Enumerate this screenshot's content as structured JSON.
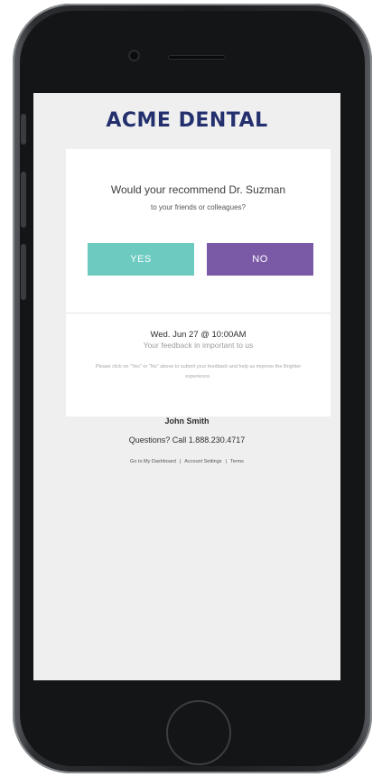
{
  "app": {
    "brand": "ACME DENTAL"
  },
  "survey": {
    "question": "Would your recommend Dr. Suzman",
    "sub_question": "to your friends or colleagues?",
    "yes_label": "YES",
    "no_label": "NO"
  },
  "appointment": {
    "date_line": "Wed. Jun 27 @ 10:00AM",
    "feedback_note": "Your feedback in important to us",
    "instructions": "Please click on \"Yes\" or \"No\" above to submit your feedback and help us improve the Brighter experience."
  },
  "footer": {
    "user_name": "John Smith",
    "questions_line": "Questions? Call 1.888.230.4717",
    "links": {
      "dashboard": "Go to My Dashboard",
      "account": "Account Settings",
      "terms": "Terms",
      "separator": "|"
    }
  },
  "colors": {
    "brand": "#23306d",
    "yes_button": "#6ccac0",
    "no_button": "#7a5aa6",
    "screen_background": "#efeff0"
  }
}
